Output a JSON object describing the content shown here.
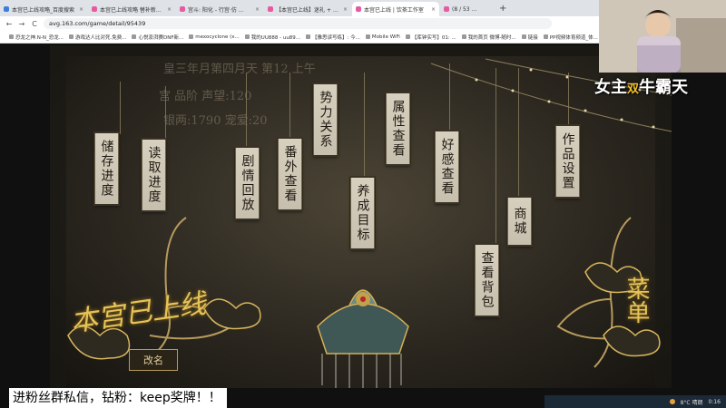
{
  "browser": {
    "tabs": [
      {
        "label": "本宫已上线攻略_百度搜索",
        "active": false
      },
      {
        "label": "本宫已上线攻略 替补新...",
        "active": false
      },
      {
        "label": "宫斗: 阳化 - 行宫·仿 ...",
        "active": false
      },
      {
        "label": "【本宫已上线】迷礼 + 弹...",
        "active": false
      },
      {
        "label": "本宫已上线 | 饮茶工作室",
        "active": true
      },
      {
        "label": "(8 / 53 ...",
        "active": false
      }
    ],
    "new_tab": "+",
    "nav": {
      "back": "←",
      "forward": "→",
      "reload": "C"
    },
    "url": "avg.163.com/game/detail/95439",
    "bookmarks": [
      "恐龙之神.N-N_恐龙...",
      "游戏达人比对死.免费...",
      "心悦澎湃赛DNF新...",
      "mexocyclone (x...",
      "我的UU888 - uu89...",
      "【雅思读写练】: 今...",
      "Mobile WiFi",
      "【库钟实写】01: ...",
      "我的首页 微博-随时...",
      "链接",
      "PP视频体育频道_体..."
    ]
  },
  "game": {
    "status_rows": [
      "皇三年月第四月天 第12 上午",
      "宫  品阶  声望:120",
      "银两:1790  宠爱:20"
    ],
    "menu": {
      "save": "储存进度",
      "load": "读取进度",
      "story": "剧情回放",
      "extras": "番外查看",
      "factions": "势力关系",
      "training": "养成目标",
      "attributes": "属性查看",
      "affection": "好感查看",
      "inventory": "查看背包",
      "shop": "商城",
      "settings": "作品设置"
    },
    "rename_button": "改名",
    "title_art": "本宫已上线",
    "side_art": "菜单"
  },
  "stream": {
    "streamer_label_pre": "女主",
    "streamer_label_accent": "双",
    "streamer_label_post": "牛霸天",
    "caption": "进粉丝群私信，钻粉：keep奖牌！！"
  },
  "taskbar": {
    "weather": "8°C 晴朗",
    "time": "0:16"
  },
  "colors": {
    "gold": "#e6c35a",
    "scroll_paper": "#d3cbba",
    "tab_favicon_pink": "#e65aa0"
  }
}
